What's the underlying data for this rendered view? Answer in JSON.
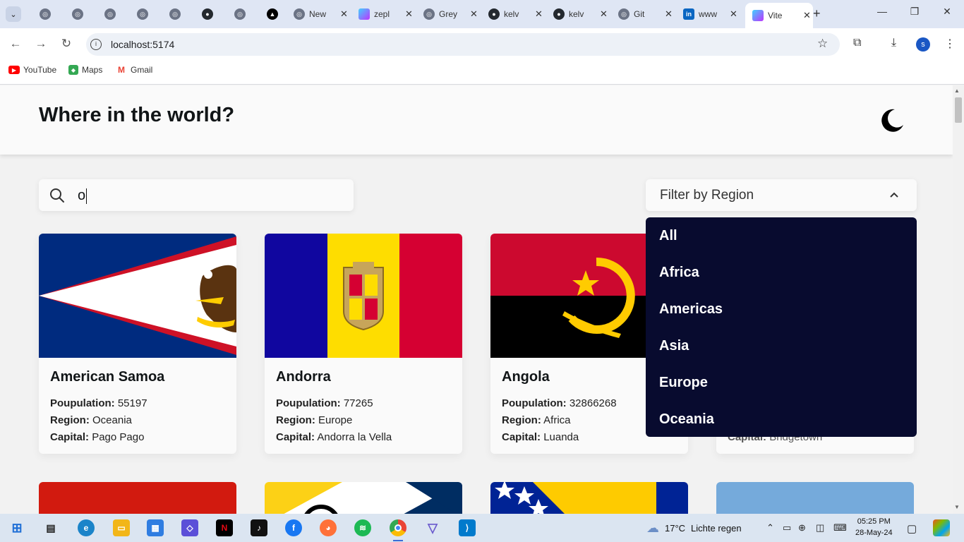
{
  "browser": {
    "tabs": [
      {
        "title": "",
        "icon": "globe-icon"
      },
      {
        "title": "",
        "icon": "globe-icon"
      },
      {
        "title": "",
        "icon": "globe-icon"
      },
      {
        "title": "",
        "icon": "globe-icon"
      },
      {
        "title": "",
        "icon": "globe-icon"
      },
      {
        "title": "",
        "icon": "github-icon"
      },
      {
        "title": "",
        "icon": "globe-icon"
      },
      {
        "title": "",
        "icon": "triangle-icon"
      },
      {
        "title": "New",
        "icon": "globe-icon"
      },
      {
        "title": "zepl",
        "icon": "vite-icon"
      },
      {
        "title": "Grey",
        "icon": "globe-icon"
      },
      {
        "title": "kelv",
        "icon": "github-icon"
      },
      {
        "title": "kelv",
        "icon": "github-icon"
      },
      {
        "title": "Git",
        "icon": "globe-icon"
      },
      {
        "title": "www",
        "icon": "linkedin-icon"
      },
      {
        "title": "Vite",
        "icon": "vite-icon"
      }
    ],
    "url": "localhost:5174",
    "bookmarks": [
      {
        "label": "YouTube",
        "icon": "youtube-icon",
        "color": "#ff0000"
      },
      {
        "label": "Maps",
        "icon": "maps-icon",
        "color": "#34a853"
      },
      {
        "label": "Gmail",
        "icon": "gmail-icon",
        "color": "#ea4335"
      }
    ],
    "profile_initial": "s"
  },
  "app": {
    "title": "Where in the world?",
    "search": {
      "value": "o"
    },
    "filter": {
      "label": "Filter by Region",
      "options": [
        "All",
        "Africa",
        "Americas",
        "Asia",
        "Europe",
        "Oceania"
      ]
    },
    "labels": {
      "population": "Poupulation:",
      "region": "Region:",
      "capital": "Capital:"
    },
    "countries": [
      {
        "name": "American Samoa",
        "population": "55197",
        "region": "Oceania",
        "capital": "Pago Pago"
      },
      {
        "name": "Andorra",
        "population": "77265",
        "region": "Europe",
        "capital": "Andorra la Vella"
      },
      {
        "name": "Angola",
        "population": "32866268",
        "region": "Africa",
        "capital": "Luanda"
      },
      {
        "name": "",
        "population": "",
        "region": "",
        "capital": "Bridgetown"
      }
    ]
  },
  "taskbar": {
    "weather": {
      "temp": "17°C",
      "desc": "Lichte regen"
    },
    "time": "05:25 PM",
    "date": "28-May-24"
  }
}
